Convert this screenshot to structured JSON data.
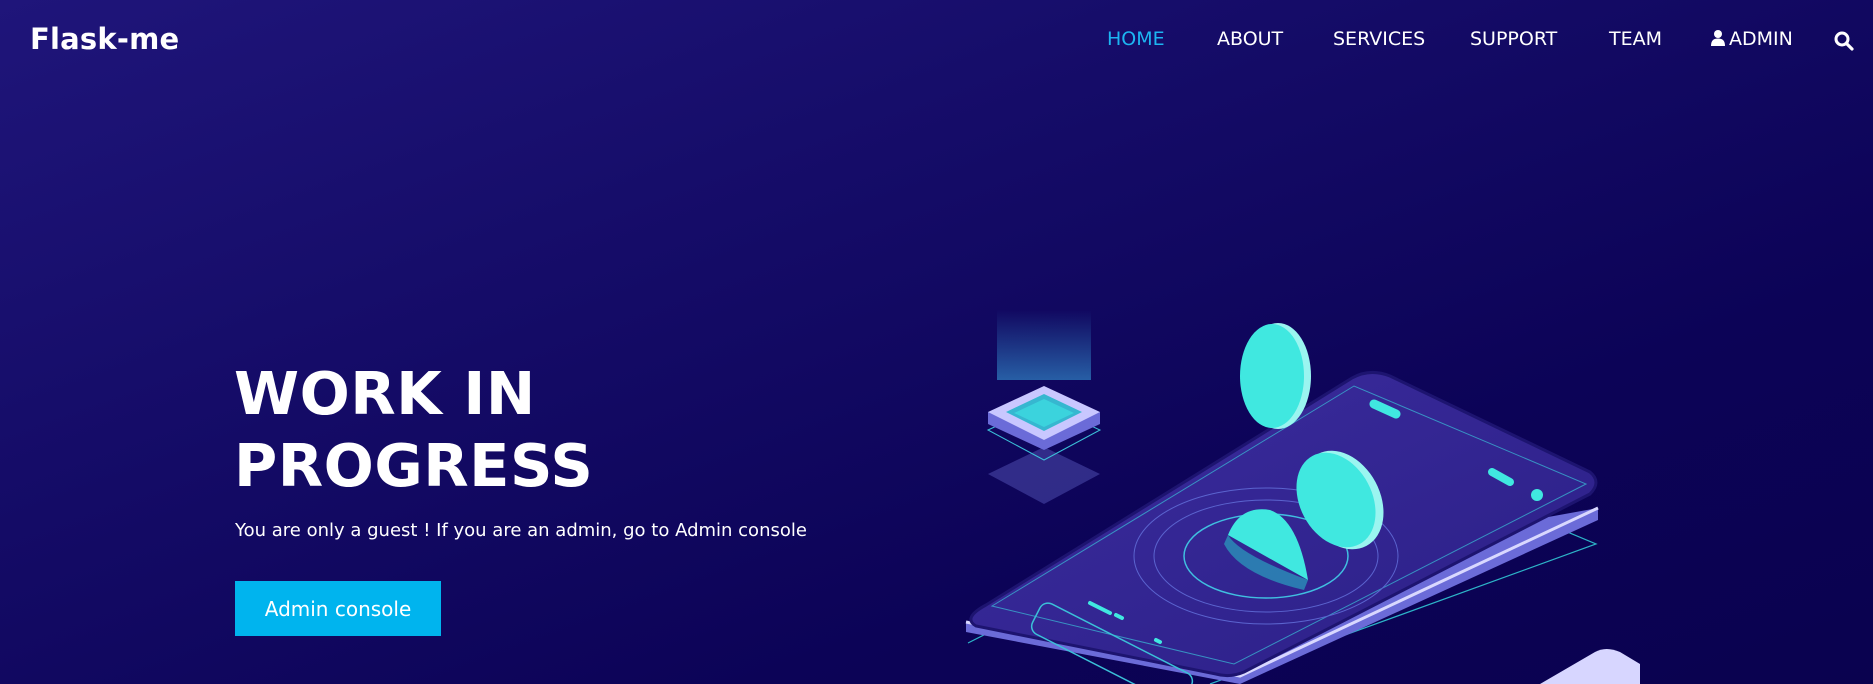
{
  "brand": "Flask-me",
  "nav": {
    "home": "HOME",
    "about": "ABOUT",
    "services": "SERVICES",
    "support": "SUPPORT",
    "team": "TEAM",
    "admin": "ADMIN",
    "admin_icon": "user-icon",
    "search_icon": "search-icon"
  },
  "hero": {
    "title_line1": "WORK IN",
    "title_line2": "PROGRESS",
    "subtitle": "You are only a guest ! If you are an admin, go to Admin console",
    "cta": "Admin console"
  },
  "colors": {
    "background": "#140a62",
    "accent": "#00b4ee",
    "active_nav": "#1cb5f2",
    "illustration_teal": "#40e8e0"
  }
}
